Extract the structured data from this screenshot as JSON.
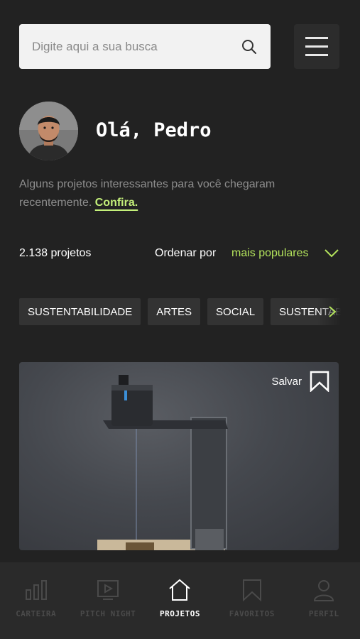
{
  "search": {
    "placeholder": "Digite aqui a sua busca",
    "icon": "search-icon"
  },
  "menu": {
    "icon": "hamburger-icon"
  },
  "profile": {
    "greeting": "Olá, Pedro"
  },
  "intro": {
    "text": "Alguns projetos interessantes para você chegaram recentemente.",
    "link": "Confira."
  },
  "projects": {
    "count": "2.138 projetos",
    "sort_label": "Ordenar por",
    "sort_value": "mais populares"
  },
  "tags": [
    "SUSTENTABILIDADE",
    "ARTES",
    "SOCIAL",
    "SUSTENTABILIDADE"
  ],
  "card": {
    "save_label": "Salvar"
  },
  "nav": [
    {
      "label": "CARTEIRA",
      "icon": "bar-chart-icon",
      "active": false
    },
    {
      "label": "PITCH NIGHT",
      "icon": "video-play-icon",
      "active": false
    },
    {
      "label": "PROJETOS",
      "icon": "home-icon",
      "active": true
    },
    {
      "label": "FAVORITOS",
      "icon": "bookmark-icon",
      "active": false
    },
    {
      "label": "PERFIL",
      "icon": "user-icon",
      "active": false
    }
  ],
  "colors": {
    "background": "#222222",
    "accent": "#b3e35c",
    "search_bg": "#f2f2f2",
    "nav_bg": "#2a2a2a"
  }
}
